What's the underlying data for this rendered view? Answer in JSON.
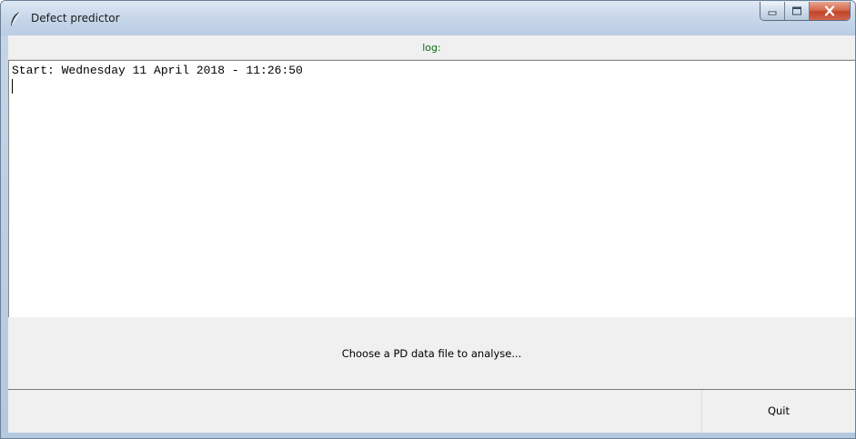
{
  "window": {
    "title": "Defect predictor",
    "icon": "feather-icon"
  },
  "window_controls": {
    "minimize_icon": "minimize-icon",
    "maximize_icon": "maximize-icon",
    "close_icon": "close-icon"
  },
  "log": {
    "label": "log:",
    "lines": [
      "Start: Wednesday 11 April 2018 - 11:26:50"
    ]
  },
  "buttons": {
    "choose_file": "Choose a PD data file to analyse...",
    "quit": "Quit"
  },
  "colors": {
    "log_label": "#0f6b12",
    "close_button": "#c24428"
  }
}
